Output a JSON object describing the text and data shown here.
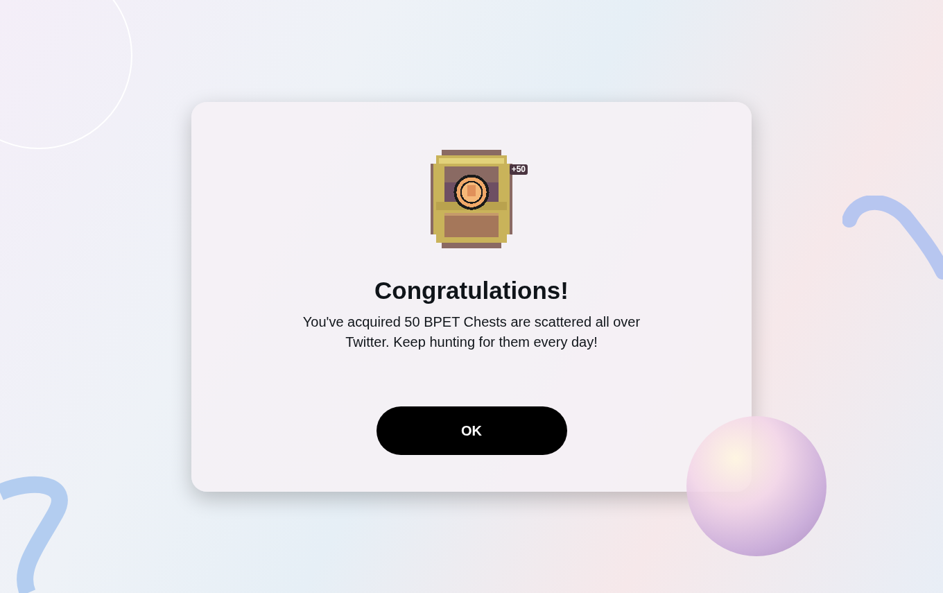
{
  "dialog": {
    "reward_badge": "+50",
    "title": "Congratulations!",
    "message": "You've acquired 50 BPET Chests are scattered all over Twitter. Keep hunting for them every day!",
    "button": "OK"
  }
}
